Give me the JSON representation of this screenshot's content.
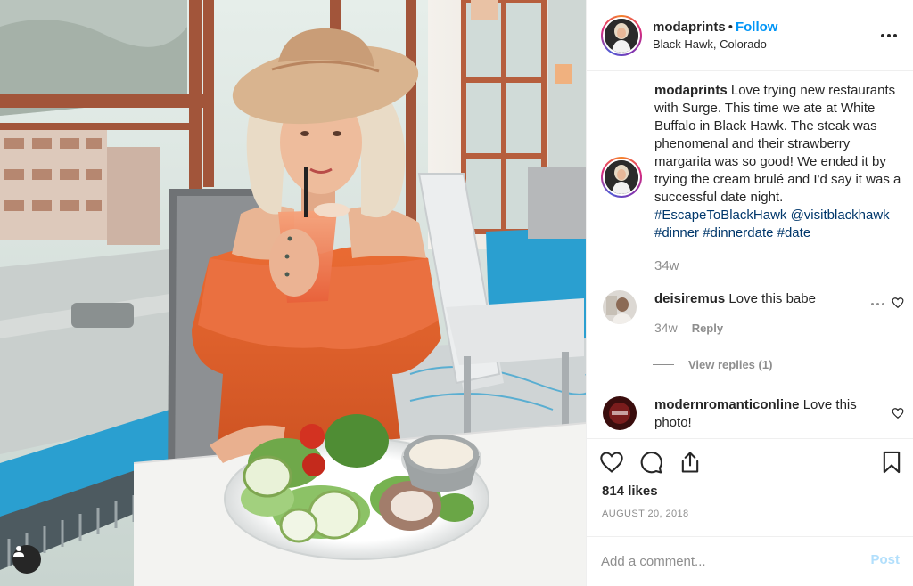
{
  "header": {
    "username": "modaprints",
    "separator": "•",
    "follow_label": "Follow",
    "location": "Black Hawk, Colorado"
  },
  "caption": {
    "username": "modaprints",
    "text": "Love trying new restaurants with Surge. This time we ate at White Buffalo in Black Hawk. The steak was phenomenal and their strawberry margarita was so good! We ended it by trying the cream brulé and I'd say it was a successful date night.",
    "hashtags": [
      "#EscapeToBlackHawk",
      "@visitblackhawk",
      "#dinner",
      "#dinnerdate",
      "#date"
    ],
    "time": "34w"
  },
  "comments": [
    {
      "username": "deisiremus",
      "text": "Love this babe",
      "time": "34w",
      "reply_label": "Reply",
      "view_replies_label": "View replies (1)"
    },
    {
      "username": "modernromanticonline",
      "text": "Love this photo!"
    }
  ],
  "actions": {
    "likes": "814 likes",
    "date": "AUGUST 20, 2018"
  },
  "add_comment": {
    "placeholder": "Add a comment...",
    "post_label": "Post"
  },
  "colors": {
    "link_blue": "#0095f6",
    "hashtag_blue": "#00376b",
    "muted_gray": "#8e8e8e",
    "post_disabled": "#b2dffc",
    "dress_orange": "#e2622f",
    "tablecloth_blue": "#2a9fd0"
  },
  "icons": [
    "more-horizontal-icon",
    "heart-icon",
    "comment-icon",
    "share-icon",
    "bookmark-icon",
    "user-tag-icon"
  ]
}
